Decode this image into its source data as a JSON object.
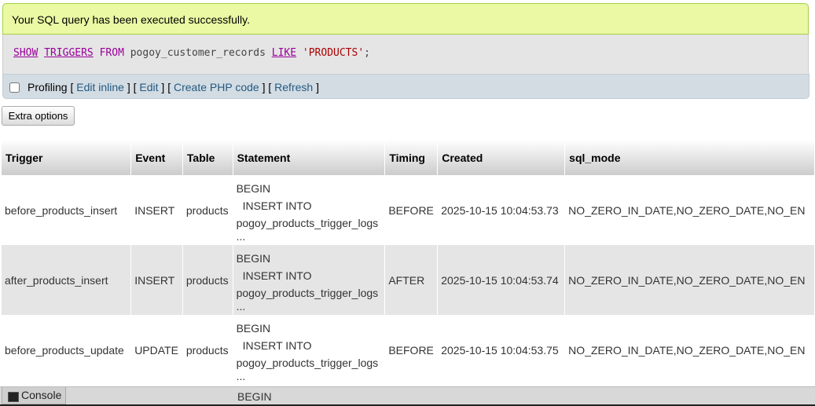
{
  "message": "Your SQL query has been executed successfully.",
  "sql": {
    "kw_show": "SHOW",
    "kw_triggers": "TRIGGERS",
    "kw_from": "FROM",
    "db": "pogoy_customer_records",
    "kw_like": "LIKE",
    "pattern": "'PRODUCTS'",
    "end": ";"
  },
  "tools": {
    "profiling": "Profiling",
    "edit_inline": "Edit inline",
    "edit": "Edit",
    "create_php": "Create PHP code",
    "refresh": "Refresh"
  },
  "extra_options": "Extra options",
  "table": {
    "headers": [
      "Trigger",
      "Event",
      "Table",
      "Statement",
      "Timing",
      "Created",
      "sql_mode"
    ],
    "rows": [
      {
        "trigger": "before_products_insert",
        "event": "INSERT",
        "table": "products",
        "stmt": [
          "BEGIN",
          "INSERT INTO",
          "pogoy_products_trigger_logs",
          "..."
        ],
        "timing": "BEFORE",
        "created": "2025-10-15 10:04:53.73",
        "sql_mode": "NO_ZERO_IN_DATE,NO_ZERO_DATE,NO_EN"
      },
      {
        "trigger": "after_products_insert",
        "event": "INSERT",
        "table": "products",
        "stmt": [
          "BEGIN",
          "INSERT INTO",
          "pogoy_products_trigger_logs",
          "..."
        ],
        "timing": "AFTER",
        "created": "2025-10-15 10:04:53.74",
        "sql_mode": "NO_ZERO_IN_DATE,NO_ZERO_DATE,NO_EN"
      },
      {
        "trigger": "before_products_update",
        "event": "UPDATE",
        "table": "products",
        "stmt": [
          "BEGIN",
          "INSERT INTO",
          "pogoy_products_trigger_logs",
          "..."
        ],
        "timing": "BEFORE",
        "created": "2025-10-15 10:04:53.75",
        "sql_mode": "NO_ZERO_IN_DATE,NO_ZERO_DATE,NO_EN"
      }
    ],
    "next_row_stmt": "BEGIN"
  },
  "console": {
    "label": "Console",
    "icon": "console-icon"
  }
}
